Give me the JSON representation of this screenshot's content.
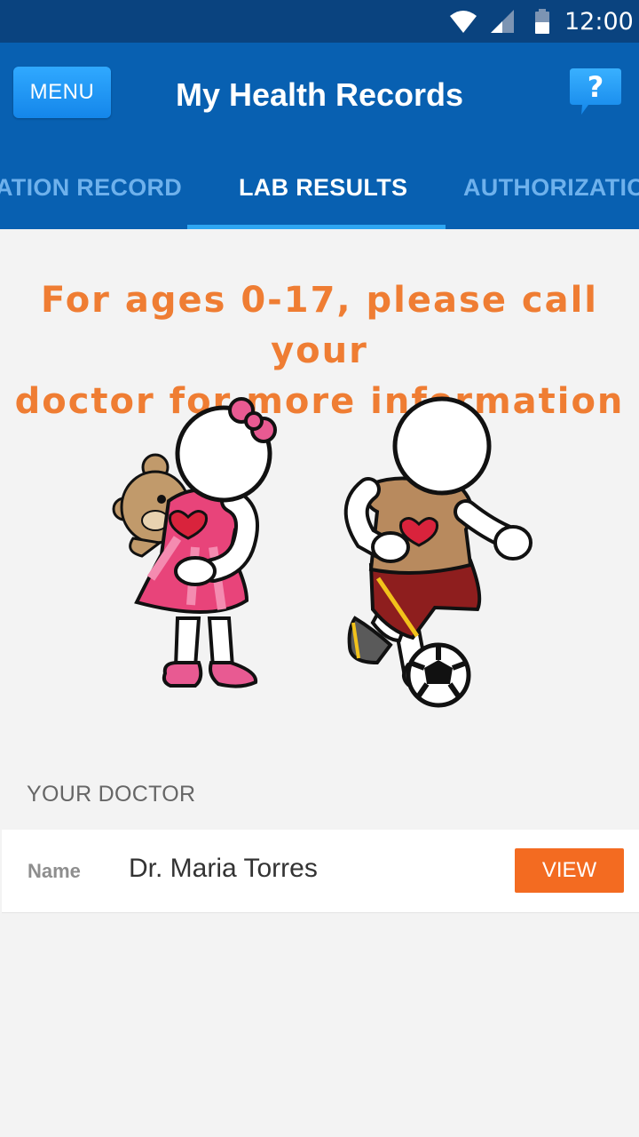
{
  "status_bar": {
    "time": "12:00"
  },
  "app_bar": {
    "menu_label": "MENU",
    "title": "My Health Records",
    "help_label": "?"
  },
  "tabs": [
    {
      "label": "ATION RECORD",
      "selected": false
    },
    {
      "label": "LAB RESULTS",
      "selected": true
    },
    {
      "label": "AUTHORIZATIC",
      "selected": false
    }
  ],
  "notice": {
    "line1": "For ages 0-17, please call your",
    "line2": "doctor for more information"
  },
  "doctor_section": {
    "title": "YOUR DOCTOR",
    "name_label": "Name",
    "name_value": "Dr. Maria Torres",
    "view_label": "VIEW"
  },
  "colors": {
    "status_bar": "#0a437f",
    "app_bar": "#0860b1",
    "tab_indicator": "#2ea6f2",
    "notice_text": "#ef7d33",
    "view_button": "#f36b21"
  },
  "icons": [
    "wifi-icon",
    "signal-icon",
    "battery-icon",
    "help-icon",
    "children-illustration"
  ]
}
